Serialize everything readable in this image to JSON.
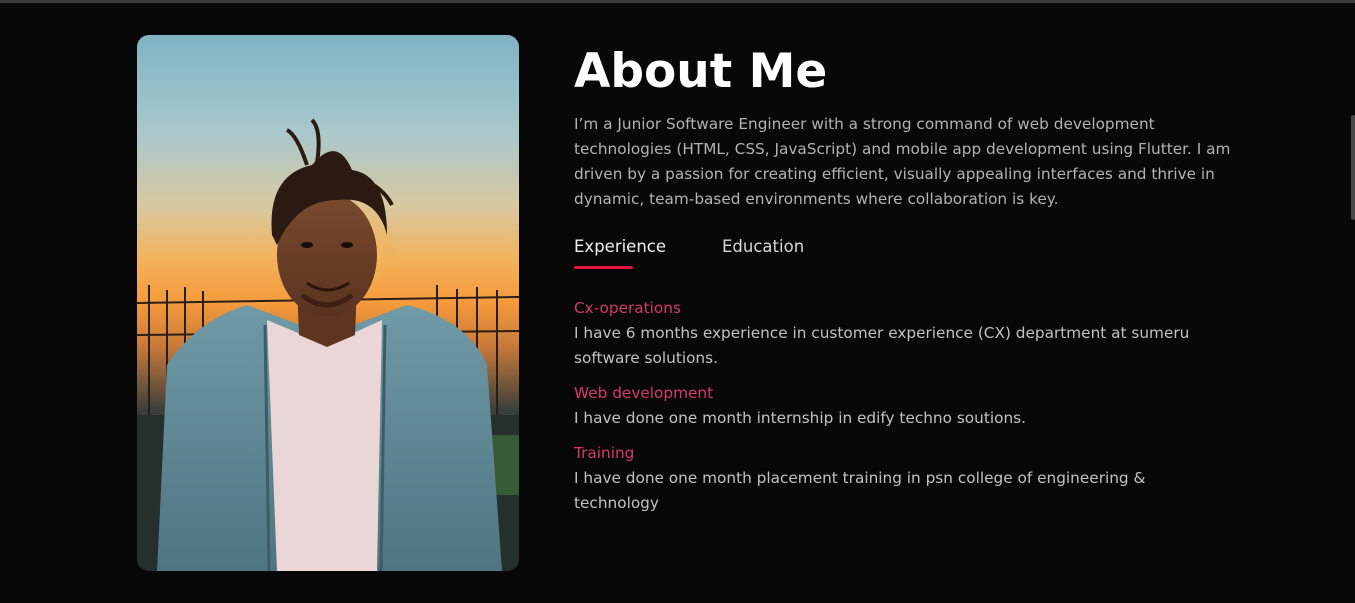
{
  "about": {
    "title": "About Me",
    "intro": "I’m a Junior Software Engineer with a strong command of web development technologies (HTML, CSS, JavaScript) and mobile app development using Flutter. I am driven by a passion for creating efficient, visually appealing interfaces and thrive in dynamic, team-based environments where collaboration is key.",
    "tabs": [
      {
        "label": "Experience",
        "active": true
      },
      {
        "label": "Education",
        "active": false
      }
    ],
    "experience": [
      {
        "title": "Cx-operations",
        "desc": "I have 6 months experience in customer experience (CX) department at sumeru software solutions."
      },
      {
        "title": "Web development",
        "desc": "I have done one month internship in edify techno soutions."
      },
      {
        "title": "Training",
        "desc": "I have done one month placement training in psn college of engineering & technology"
      }
    ]
  },
  "colors": {
    "background": "#080808",
    "accent": "#e2123b",
    "item_title": "#d6386a",
    "text": "#b3b3b3"
  }
}
